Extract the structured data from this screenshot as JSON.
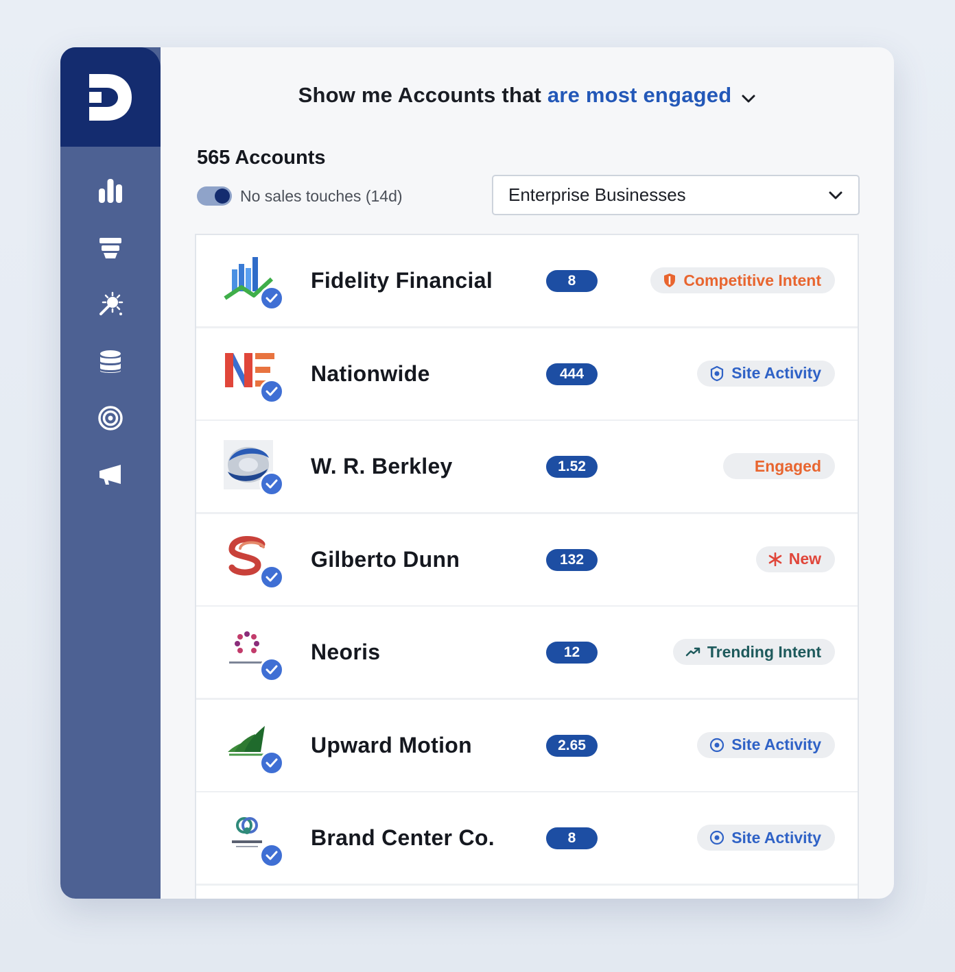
{
  "app": {
    "logo_letter": "D"
  },
  "sidebar": {
    "items": [
      {
        "icon": "bar-chart-icon"
      },
      {
        "icon": "funnel-icon"
      },
      {
        "icon": "sparkle-wand-icon"
      },
      {
        "icon": "database-icon"
      },
      {
        "icon": "target-icon"
      },
      {
        "icon": "megaphone-icon"
      }
    ]
  },
  "header": {
    "prefix": "Show me Accounts that ",
    "highlight": "are most engaged",
    "highlight_color": "#2358b8"
  },
  "summary": {
    "count_label": "565 Accounts"
  },
  "filter": {
    "toggle_label": "No sales touches (14d)",
    "toggle_on": true,
    "segment_value": "Enterprise Businesses"
  },
  "accounts": [
    {
      "name": "Fidelity Financial",
      "score": "8",
      "tag": "Competitive Intent",
      "tag_icon": "shield-icon",
      "tag_color": "#e8652f"
    },
    {
      "name": "Nationwide",
      "score": "444",
      "tag": "Site Activity",
      "tag_icon": "site-activity-icon",
      "tag_color": "#2f62c6"
    },
    {
      "name": "W. R. Berkley",
      "score": "1.52",
      "tag": "Engaged",
      "tag_icon": "",
      "tag_color": "#e8652f"
    },
    {
      "name": "Gilberto Dunn",
      "score": "132",
      "tag": "New",
      "tag_icon": "asterisk-icon",
      "tag_color": "#e0463a"
    },
    {
      "name": "Neoris",
      "score": "12",
      "tag": "Trending Intent",
      "tag_icon": "trend-up-icon",
      "tag_color": "#1e5a5c"
    },
    {
      "name": "Upward Motion",
      "score": "2.65",
      "tag": "Site Activity",
      "tag_icon": "site-activity-icon",
      "tag_color": "#2f62c6"
    },
    {
      "name": "Brand Center Co.",
      "score": "8",
      "tag": "Site Activity",
      "tag_icon": "site-activity-icon",
      "tag_color": "#2f62c6"
    }
  ]
}
